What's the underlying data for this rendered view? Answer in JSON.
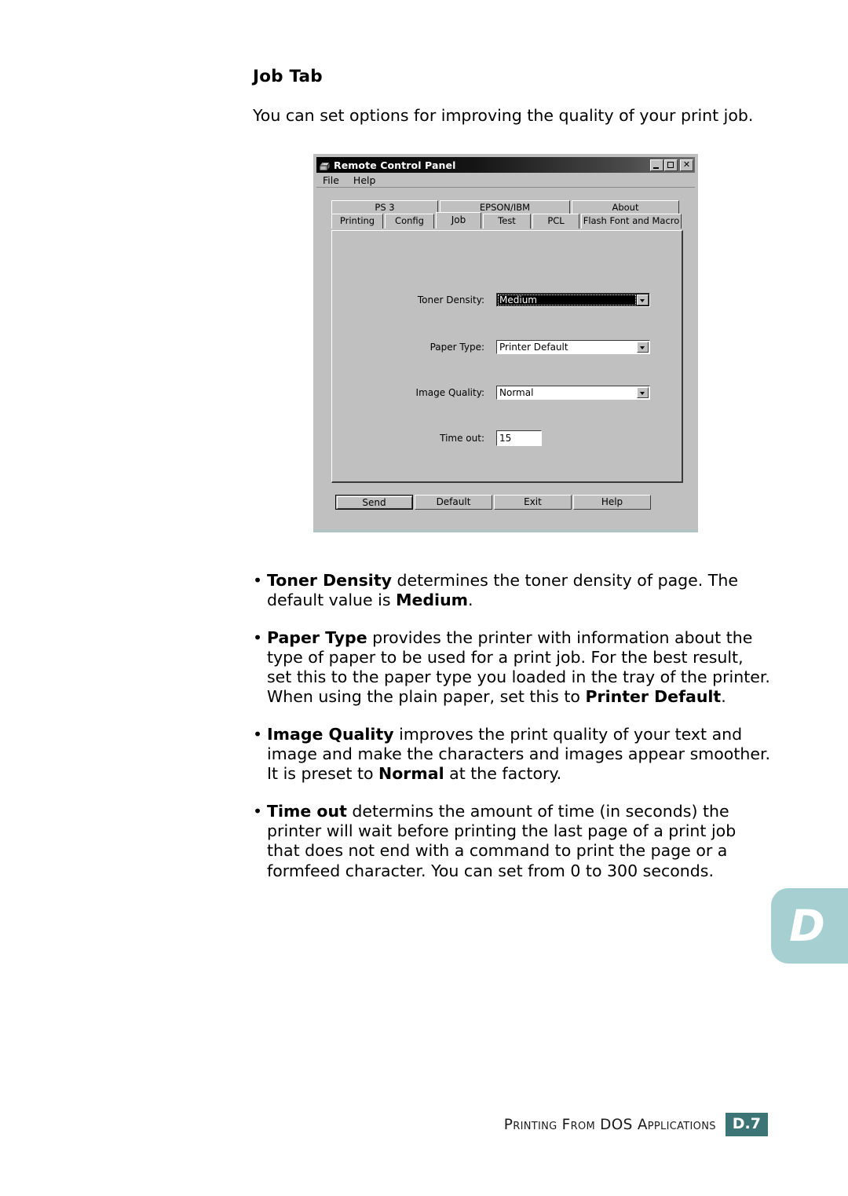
{
  "document": {
    "heading": "Job Tab",
    "intro": "You can set options for improving the quality of your print job."
  },
  "dialog": {
    "title": "Remote Control Panel",
    "title_icon": "printer-icon",
    "window_controls": {
      "minimize": "minimize-icon",
      "maximize": "maximize-icon",
      "close": "close-icon"
    },
    "menus": [
      "File",
      "Help"
    ],
    "tabs_top": [
      "PS 3",
      "EPSON/IBM",
      "About"
    ],
    "tabs_bottom": [
      "Printing",
      "Config",
      "Job",
      "Test",
      "PCL",
      "Flash Font and Macro"
    ],
    "active_tab": "Job",
    "fields": [
      {
        "label": "Toner Density:",
        "type": "combobox",
        "value": "Medium",
        "focused": true
      },
      {
        "label": "Paper Type:",
        "type": "combobox",
        "value": "Printer Default",
        "focused": false
      },
      {
        "label": "Image Quality:",
        "type": "combobox",
        "value": "Normal",
        "focused": false
      },
      {
        "label": "Time out:",
        "type": "textbox",
        "value": "15",
        "focused": false
      }
    ],
    "buttons": [
      {
        "label": "Send",
        "default": true
      },
      {
        "label": "Default",
        "default": false
      },
      {
        "label": "Exit",
        "default": false
      },
      {
        "label": "Help",
        "default": false
      }
    ]
  },
  "bullets": [
    {
      "marker": "•",
      "parts": [
        {
          "text": "Toner Density",
          "bold": true
        },
        {
          "text": " determines the toner density of page. The default value is ",
          "bold": false
        },
        {
          "text": "Medium",
          "bold": true
        },
        {
          "text": ".",
          "bold": false
        }
      ]
    },
    {
      "marker": "•",
      "parts": [
        {
          "text": "Paper Type",
          "bold": true
        },
        {
          "text": " provides the printer with information about the type of paper to be used for a print job. For the best result, set this to the paper type you loaded in the tray of the printer. When using the plain paper, set this to ",
          "bold": false
        },
        {
          "text": "Printer Default",
          "bold": true
        },
        {
          "text": ".",
          "bold": false
        }
      ]
    },
    {
      "marker": "•",
      "parts": [
        {
          "text": "Image Quality",
          "bold": true
        },
        {
          "text": " improves the print quality of your text and image and make the characters and images appear smoother. It is preset to ",
          "bold": false
        },
        {
          "text": "Normal",
          "bold": true
        },
        {
          "text": " at the factory.",
          "bold": false
        }
      ]
    },
    {
      "marker": "•",
      "parts": [
        {
          "text": "Time out",
          "bold": true
        },
        {
          "text": " determins the amount of time (in seconds) the printer will wait before printing the last page of a print job that does not end with a command to print the page or a formfeed character. You can set from 0 to 300 seconds.",
          "bold": false
        }
      ]
    }
  ],
  "side_tab": {
    "letter": "D",
    "color": "#a5cfd0"
  },
  "footer": {
    "text": "Printing From DOS Applications",
    "page_number": "D.7",
    "badge_color": "#3d7576"
  }
}
